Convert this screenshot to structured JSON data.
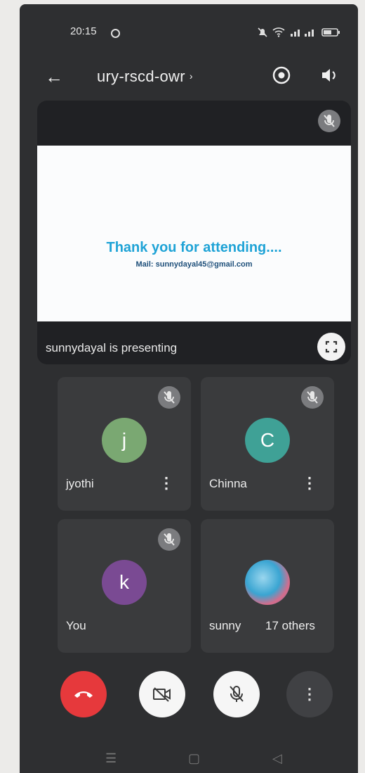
{
  "status_bar": {
    "time": "20:15"
  },
  "header": {
    "meeting_code": "ury-rscd-owr",
    "chevron": "›"
  },
  "presentation": {
    "slide_title": "Thank you for attending....",
    "slide_subtitle": "Mail: sunnydayal45@gmail.com",
    "presenter_label": "sunnydayal is presenting"
  },
  "participants": [
    {
      "name": "jyothi",
      "initial": "j",
      "color": "#7aa872",
      "muted": true
    },
    {
      "name": "Chinna",
      "initial": "C",
      "color": "#3fa196",
      "muted": true
    },
    {
      "name": "You",
      "initial": "k",
      "color": "#7a4a93",
      "muted": true
    },
    {
      "name": "sunny",
      "others": "17 others",
      "muted": false
    }
  ],
  "controls": {
    "end_call": "end-call-icon",
    "camera": "camera-off-icon",
    "mic": "mic-off-icon",
    "more": "⋮"
  },
  "nav": {
    "recents": "☰",
    "home": "▢",
    "back": "◁"
  },
  "colors": {
    "end_call": "#e6393c",
    "accent_text": "#1fa3d6"
  }
}
